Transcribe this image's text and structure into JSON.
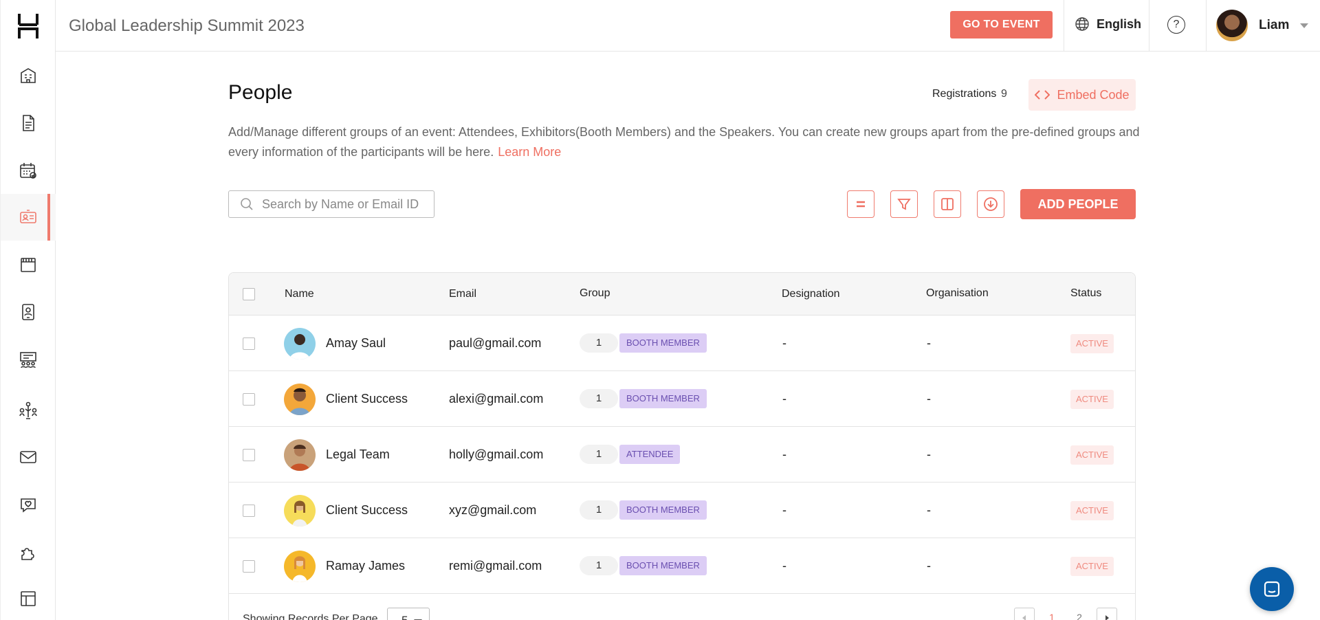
{
  "header": {
    "event_title": "Global Leadership Summit 2023",
    "go_to_event": "GO TO EVENT",
    "language": "English",
    "help_symbol": "?",
    "user_name": "Liam"
  },
  "sidebar": {
    "items": [
      {
        "icon": "building-icon"
      },
      {
        "icon": "document-icon"
      },
      {
        "icon": "calendar-check-icon"
      },
      {
        "icon": "id-card-icon",
        "active": true
      },
      {
        "icon": "booth-icon"
      },
      {
        "icon": "badge-icon"
      },
      {
        "icon": "presentation-icon"
      },
      {
        "icon": "networking-icon"
      },
      {
        "icon": "mail-icon"
      },
      {
        "icon": "chat-heart-icon"
      },
      {
        "icon": "puzzle-icon"
      },
      {
        "icon": "layout-icon"
      }
    ]
  },
  "page": {
    "title": "People",
    "registrations_label": "Registrations",
    "registrations_count": "9",
    "embed_code": "Embed Code",
    "description": "Add/Manage different groups of an event: Attendees, Exhibitors(Booth Members) and the Speakers. You can create new groups apart from the pre-defined groups and every information of the participants will be here.",
    "learn_more": "Learn More",
    "search_placeholder": "Search by Name or Email ID",
    "add_people": "ADD PEOPLE"
  },
  "table": {
    "headers": {
      "name": "Name",
      "email": "Email",
      "group": "Group",
      "designation": "Designation",
      "organisation": "Organisation",
      "status": "Status"
    },
    "rows": [
      {
        "name": "Amay Saul",
        "email": "paul@gmail.com",
        "group_count": "1",
        "group": "BOOTH MEMBER",
        "designation": "-",
        "organisation": "-",
        "status": "ACTIVE",
        "avatar_color": "#8fd0e8"
      },
      {
        "name": "Client Success",
        "email": "alexi@gmail.com",
        "group_count": "1",
        "group": "BOOTH MEMBER",
        "designation": "-",
        "organisation": "-",
        "status": "ACTIVE",
        "avatar_color": "#f3a73a"
      },
      {
        "name": "Legal Team",
        "email": "holly@gmail.com",
        "group_count": "1",
        "group": "ATTENDEE",
        "designation": "-",
        "organisation": "-",
        "status": "ACTIVE",
        "avatar_color": "#c9a27a"
      },
      {
        "name": "Client Success",
        "email": "xyz@gmail.com",
        "group_count": "1",
        "group": "BOOTH MEMBER",
        "designation": "-",
        "organisation": "-",
        "status": "ACTIVE",
        "avatar_color": "#f6dc5a"
      },
      {
        "name": "Ramay James",
        "email": "remi@gmail.com",
        "group_count": "1",
        "group": "BOOTH MEMBER",
        "designation": "-",
        "organisation": "-",
        "status": "ACTIVE",
        "avatar_color": "#f5b82a"
      }
    ],
    "footer": {
      "per_page_label": "Showing Records Per Page",
      "per_page_value": "5",
      "pages": [
        "1",
        "2"
      ],
      "current_page": "1"
    }
  },
  "colors": {
    "accent": "#ef6f61",
    "badge_bg": "#dccdf5",
    "status_bg": "#fdeceb",
    "fab": "#0a5ea8"
  }
}
